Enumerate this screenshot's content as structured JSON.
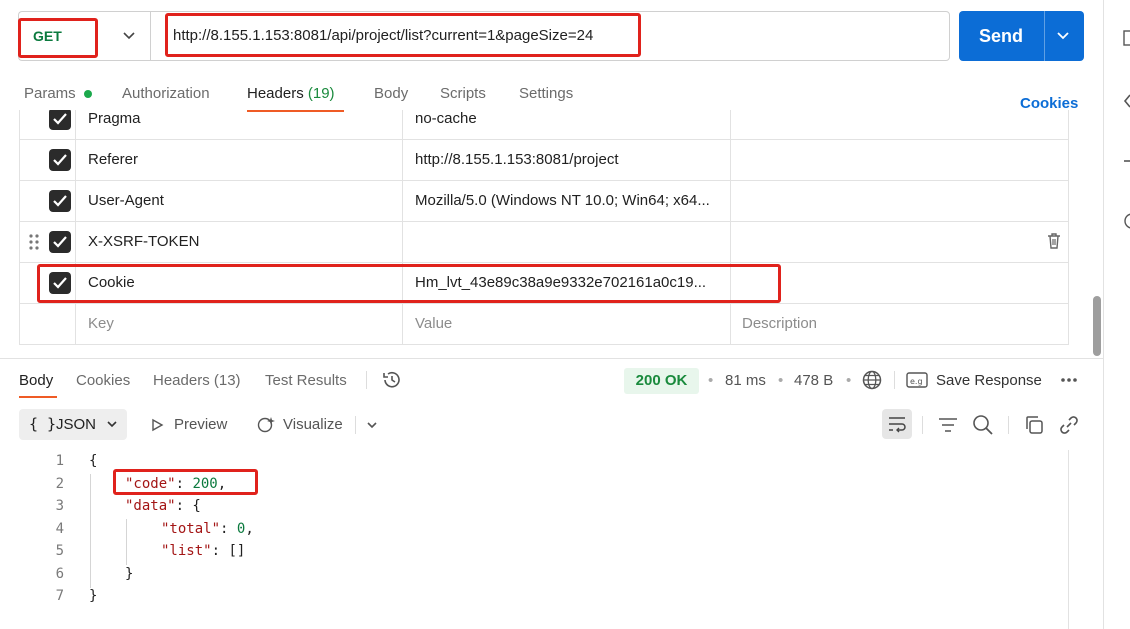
{
  "request": {
    "method": "GET",
    "url": "http://8.155.1.153:8081/api/project/list?current=1&pageSize=24",
    "send_label": "Send"
  },
  "request_tabs": {
    "params": "Params",
    "authorization": "Authorization",
    "headers": "Headers",
    "headers_count": "(19)",
    "body": "Body",
    "scripts": "Scripts",
    "settings": "Settings",
    "cookies_link": "Cookies"
  },
  "headers_table": {
    "rows": [
      {
        "key": "Pragma",
        "value": "no-cache",
        "checked": true
      },
      {
        "key": "Referer",
        "value": "http://8.155.1.153:8081/project",
        "checked": true
      },
      {
        "key": "User-Agent",
        "value": "Mozilla/5.0 (Windows NT 10.0; Win64; x64...",
        "checked": true
      },
      {
        "key": "X-XSRF-TOKEN",
        "value": "",
        "checked": true
      },
      {
        "key": "Cookie",
        "value": "Hm_lvt_43e89c38a9e9332e702161a0c19...",
        "checked": true
      }
    ],
    "placeholder": {
      "key": "Key",
      "value": "Value",
      "description": "Description"
    }
  },
  "response_tabs": {
    "body": "Body",
    "cookies": "Cookies",
    "headers": "Headers (13)",
    "test_results": "Test Results"
  },
  "response_meta": {
    "status": "200 OK",
    "time": "81 ms",
    "size": "478 B",
    "save_response": "Save Response"
  },
  "response_toolbar": {
    "format_braces": "{ }",
    "format": "JSON",
    "preview": "Preview",
    "visualize": "Visualize"
  },
  "response_body": {
    "line_numbers": [
      "1",
      "2",
      "3",
      "4",
      "5",
      "6",
      "7"
    ],
    "code_key": "\"code\"",
    "code_value": "200",
    "data_key": "\"data\"",
    "total_key": "\"total\"",
    "total_value": "0",
    "list_key": "\"list\"",
    "list_value": "[]"
  },
  "colors": {
    "send_button": "#0c6dd6",
    "method_get": "#0b7a3e",
    "highlight_box": "#e0221c",
    "active_tab_underline": "#ef5b25",
    "status_ok": "#1a8a3d"
  }
}
